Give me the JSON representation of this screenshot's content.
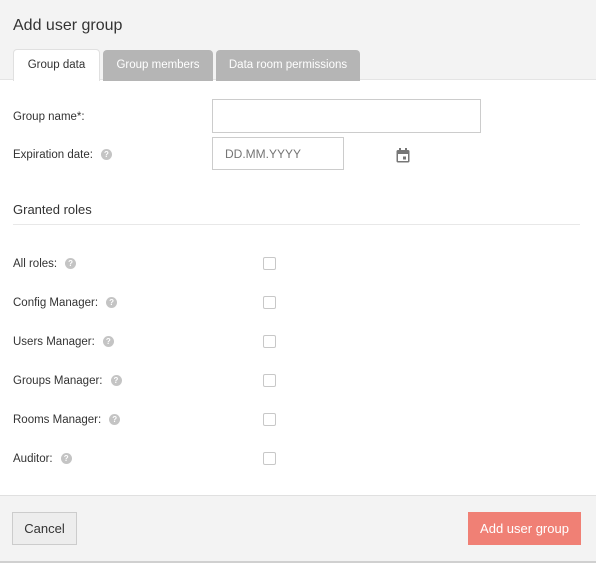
{
  "dialog": {
    "title": "Add user group"
  },
  "tabs": [
    {
      "label": "Group data",
      "active": true
    },
    {
      "label": "Group members",
      "active": false
    },
    {
      "label": "Data room permissions",
      "active": false
    }
  ],
  "form": {
    "group_name": {
      "label": "Group name*:",
      "value": ""
    },
    "expiration": {
      "label": "Expiration date:",
      "placeholder": "DD.MM.YYYY",
      "value": ""
    },
    "help_glyph": "?"
  },
  "roles": {
    "title": "Granted roles",
    "items": [
      {
        "label": "All roles:",
        "checked": false
      },
      {
        "label": "Config Manager:",
        "checked": false
      },
      {
        "label": "Users Manager:",
        "checked": false
      },
      {
        "label": "Groups Manager:",
        "checked": false
      },
      {
        "label": "Rooms Manager:",
        "checked": false
      },
      {
        "label": "Auditor:",
        "checked": false
      }
    ]
  },
  "footer": {
    "cancel_label": "Cancel",
    "submit_label": "Add user group"
  },
  "colors": {
    "primary": "#f08075",
    "tab_inactive": "#b5b5b5",
    "header_bg": "#f3f3f3"
  }
}
